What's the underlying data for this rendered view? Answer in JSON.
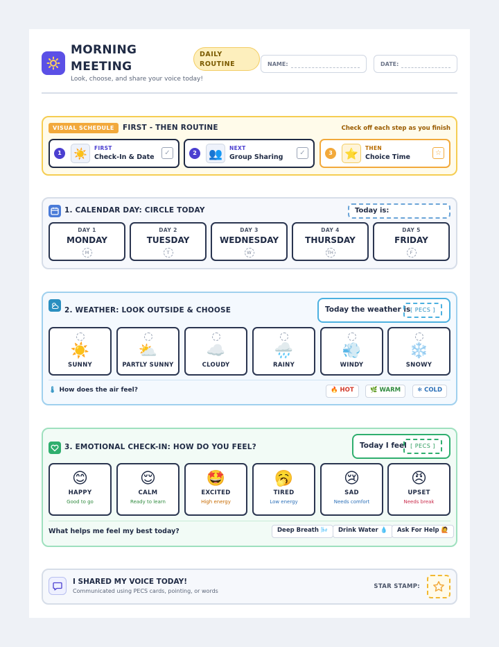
{
  "header": {
    "title": "MORNING MEETING",
    "subtitle": "Look, choose, and share your voice today!",
    "pill": "DAILY ROUTINE",
    "name_label": "NAME:",
    "date_label": "DATE:"
  },
  "schedule": {
    "tag": "VISUAL SCHEDULE",
    "title": "FIRST - THEN ROUTINE",
    "hint": "Check off each step as you finish",
    "steps": [
      {
        "num": "1",
        "kicker": "FIRST",
        "label": "Check-In & Date",
        "icon": "☀️",
        "check": "✓"
      },
      {
        "num": "2",
        "kicker": "NEXT",
        "label": "Group Sharing",
        "icon": "👥",
        "check": "✓"
      },
      {
        "num": "3",
        "kicker": "THEN",
        "label": "Choice Time",
        "icon": "⭐",
        "check": "☆"
      }
    ]
  },
  "calendar": {
    "title": "1. CALENDAR DAY: CIRCLE TODAY",
    "today_label": "Today is:",
    "days": [
      {
        "kicker": "DAY 1",
        "name": "MONDAY",
        "abbr": "M"
      },
      {
        "kicker": "DAY 2",
        "name": "TUESDAY",
        "abbr": "T"
      },
      {
        "kicker": "DAY 3",
        "name": "WEDNESDAY",
        "abbr": "W"
      },
      {
        "kicker": "DAY 4",
        "name": "THURSDAY",
        "abbr": "TH"
      },
      {
        "kicker": "DAY 5",
        "name": "FRIDAY",
        "abbr": "F"
      }
    ]
  },
  "weather": {
    "title": "2. WEATHER: LOOK OUTSIDE & CHOOSE",
    "today_label": "Today the weather is",
    "pecs": "[ PECS ]",
    "cards": [
      {
        "name": "SUNNY",
        "icon": "☀️"
      },
      {
        "name": "PARTLY SUNNY",
        "icon": "⛅"
      },
      {
        "name": "CLOUDY",
        "icon": "☁️"
      },
      {
        "name": "RAINY",
        "icon": "🌧️"
      },
      {
        "name": "WINDY",
        "icon": "💨"
      },
      {
        "name": "SNOWY",
        "icon": "❄️"
      }
    ],
    "air_question": "How does the air feel?",
    "air": [
      {
        "label": "🔥 HOT",
        "color": "#d23a2a"
      },
      {
        "label": "🌿 WARM",
        "color": "#2f8a3e"
      },
      {
        "label": "❄ COLD",
        "color": "#2a6fb8"
      }
    ]
  },
  "emotion": {
    "title": "3. EMOTIONAL CHECK-IN: HOW DO YOU FEEL?",
    "today_label": "Today I feel",
    "pecs": "[ PECS ]",
    "cards": [
      {
        "name": "HAPPY",
        "icon": "😊",
        "sub": "Good to go",
        "color": "#2f8a3e"
      },
      {
        "name": "CALM",
        "icon": "😌",
        "sub": "Ready to learn",
        "color": "#2f8a3e"
      },
      {
        "name": "EXCITED",
        "icon": "🤩",
        "sub": "High energy",
        "color": "#c76a00"
      },
      {
        "name": "TIRED",
        "icon": "🥱",
        "sub": "Low energy",
        "color": "#2a6fb8"
      },
      {
        "name": "SAD",
        "icon": "😢",
        "sub": "Needs comfort",
        "color": "#2a6fb8"
      },
      {
        "name": "UPSET",
        "icon": "😠",
        "sub": "Needs break",
        "color": "#c92a4a"
      }
    ],
    "helps_question": "What helps me feel my best today?",
    "helps": [
      "Deep Breath 🌬️",
      "Drink Water 💧",
      "Ask For Help 🙋"
    ]
  },
  "voice": {
    "title": "I SHARED MY VOICE TODAY!",
    "subtitle": "Communicated using PECS cards, pointing, or words",
    "stamp_label": "STAR STAMP:"
  },
  "colors": {
    "accent": "#5b50e6",
    "schedule": "#f5cd52",
    "weather": "#4bb0e0",
    "emotion": "#2fae6e"
  }
}
